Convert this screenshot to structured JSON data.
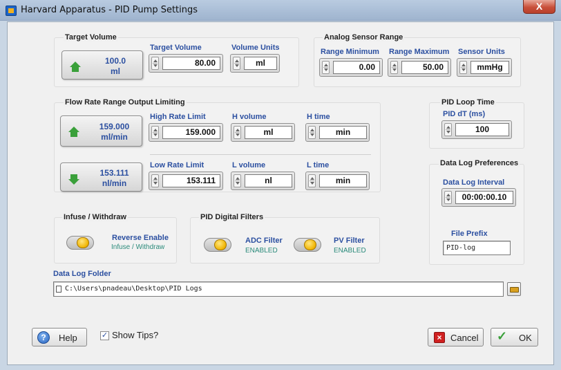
{
  "window": {
    "title": "Harvard Apparatus - PID Pump Settings",
    "close_glyph": "X"
  },
  "target_volume": {
    "group_title": "Target Volume",
    "indicator_value": "100.0",
    "indicator_unit": "ml",
    "value_label": "Target Volume",
    "value": "80.00",
    "units_label": "Volume Units",
    "units": "ml"
  },
  "analog_sensor": {
    "group_title": "Analog Sensor Range",
    "min_label": "Range Minimum",
    "min": "0.00",
    "max_label": "Range Maximum",
    "max": "50.00",
    "units_label": "Sensor Units",
    "units": "mmHg"
  },
  "flow_rate": {
    "group_title": "Flow Rate Range Output Limiting",
    "high": {
      "indicator_value": "159.000",
      "indicator_unit": "ml/min",
      "limit_label": "High Rate Limit",
      "limit": "159.000",
      "volume_label": "H volume",
      "volume": "ml",
      "time_label": "H time",
      "time": "min"
    },
    "low": {
      "indicator_value": "153.111",
      "indicator_unit": "nl/min",
      "limit_label": "Low Rate Limit",
      "limit": "153.111",
      "volume_label": "L volume",
      "volume": "nl",
      "time_label": "L time",
      "time": "min"
    }
  },
  "pid_loop": {
    "group_title": "PID Loop Time",
    "dt_label": "PID dT (ms)",
    "dt": "100"
  },
  "data_log_prefs": {
    "group_title": "Data Log Preferences",
    "interval_label": "Data Log Interval",
    "interval": "00:00:00.10",
    "prefix_label": "File Prefix",
    "prefix": "PID-log"
  },
  "infuse_withdraw": {
    "group_title": "Infuse / Withdraw",
    "toggle_label": "Reverse Enable",
    "toggle_sub": "Infuse / Withdraw"
  },
  "pid_filters": {
    "group_title": "PID Digital Filters",
    "adc_label": "ADC Filter",
    "adc_state": "ENABLED",
    "pv_label": "PV Filter",
    "pv_state": "ENABLED"
  },
  "data_log_folder": {
    "label": "Data Log Folder",
    "path": "C:\\Users\\pnadeau\\Desktop\\PID Logs"
  },
  "footer": {
    "help_label": "Help",
    "show_tips_label": "Show Tips?",
    "show_tips_checked": true,
    "cancel_label": "Cancel",
    "ok_label": "OK"
  },
  "colors": {
    "label_blue": "#2b4fa0",
    "status_teal": "#2a8a7a",
    "toggle_yellow": "#f0b400",
    "arrow_green": "#3aa03a"
  }
}
